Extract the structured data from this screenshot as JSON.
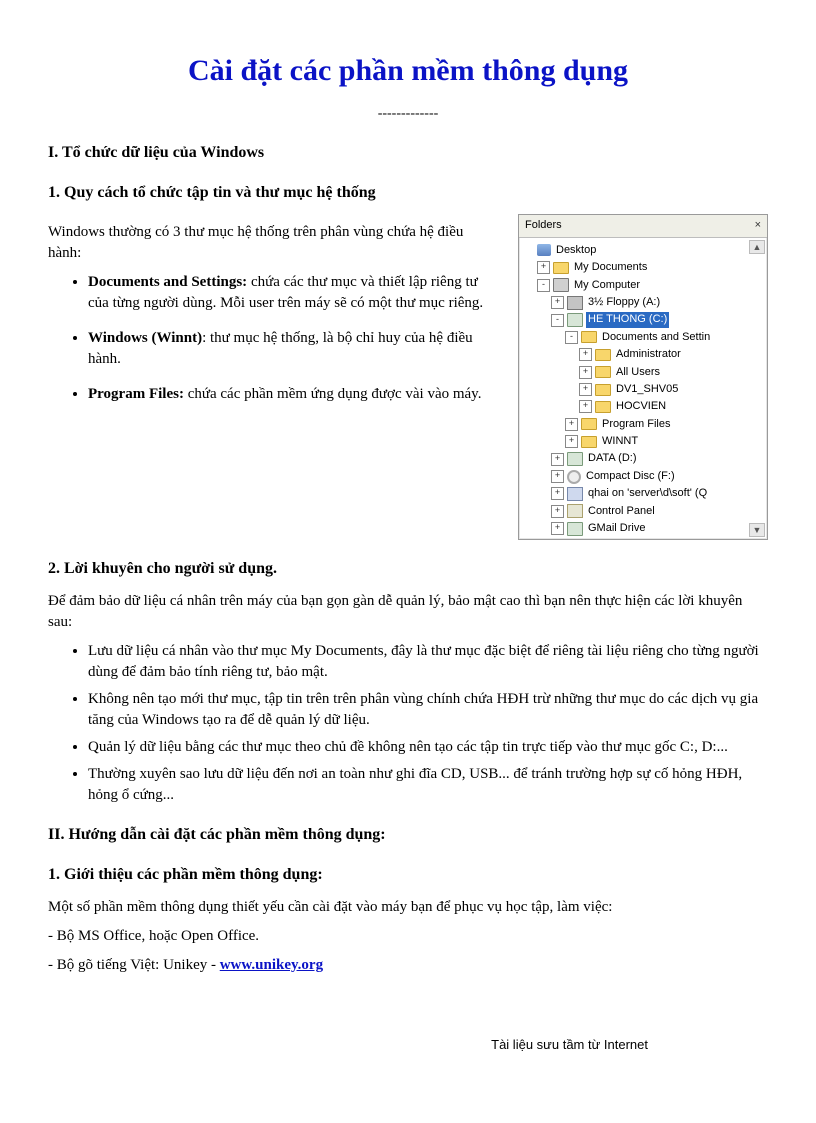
{
  "title": "Cài đặt các phần mềm thông dụng",
  "divider": "-------------",
  "section1": {
    "heading": "I.  Tổ chức dữ liệu của Windows",
    "sub1": {
      "heading": "1. Quy cách tổ chức tập tin và thư mục hệ thống",
      "intro": "Windows thường có 3 thư mục hệ thống trên phân vùng chứa hệ điều hành:",
      "bullets": [
        {
          "bold": "Documents and Settings:",
          "rest": " chứa các thư mục và thiết lập riêng tư của từng người dùng. Mỗi user trên máy sẽ có một thư mục riêng."
        },
        {
          "bold": "Windows (Winnt)",
          "rest": ": thư mục hệ thống, là bộ chỉ huy của hệ điều hành."
        },
        {
          "bold": "Program Files:",
          "rest": " chứa các phần mềm ứng dụng được vài vào máy."
        }
      ]
    },
    "sub2": {
      "heading": "2. Lời khuyên cho người sử dụng.",
      "intro": "Để đảm bảo dữ liệu cá nhân trên máy của bạn gọn gàn dễ quản lý, bảo mật cao thì bạn nên thực hiện các lời khuyên sau:",
      "bullets": [
        "Lưu dữ liệu cá nhân vào thư mục My Documents, đây là thư mục đặc biệt để riêng tài liệu riêng cho từng người dùng để đảm bảo tính riêng tư, bảo mật.",
        "Không nên tạo mới thư mục, tập tin trên trên phân vùng chính chứa HĐH trừ những thư mục do các dịch vụ gia tăng của Windows tạo ra để dễ quản lý dữ liệu.",
        "Quản lý dữ liệu bằng các thư mục theo chủ đề không nên tạo các tập tin trực tiếp vào thư mục gốc C:, D:...",
        "Thường xuyên sao lưu dữ liệu đến nơi an toàn như ghi đĩa CD, USB... để tránh trường hợp sự cố hỏng HĐH, hỏng ổ cứng..."
      ]
    }
  },
  "section2": {
    "heading": "II. Hướng dẫn cài đặt các phần mềm thông dụng:",
    "sub1": {
      "heading": "1. Giới thiệu các phần mềm thông dụng:",
      "intro": "Một số phần mềm thông dụng thiết yếu cần cài đặt vào máy bạn để phục vụ học tập, làm việc:",
      "line1": "- Bộ MS Office, hoặc Open Office.",
      "line2_prefix": "- Bộ gõ tiếng Việt: Unikey - ",
      "link": "www.unikey.org"
    }
  },
  "folders": {
    "title": "Folders",
    "close": "×",
    "scroll_up": "▲",
    "scroll_down": "▼",
    "nodes": [
      {
        "indent": 0,
        "exp": "",
        "icon": "desktop",
        "label": "Desktop",
        "sel": false
      },
      {
        "indent": 1,
        "exp": "+",
        "icon": "folder",
        "label": "My Documents",
        "sel": false
      },
      {
        "indent": 1,
        "exp": "-",
        "icon": "computer",
        "label": "My Computer",
        "sel": false
      },
      {
        "indent": 2,
        "exp": "+",
        "icon": "floppy",
        "label": "3½ Floppy (A:)",
        "sel": false
      },
      {
        "indent": 2,
        "exp": "-",
        "icon": "drive",
        "label": "HE THONG (C:)",
        "sel": true
      },
      {
        "indent": 3,
        "exp": "-",
        "icon": "folder",
        "label": "Documents and Settin",
        "sel": false
      },
      {
        "indent": 4,
        "exp": "+",
        "icon": "folder",
        "label": "Administrator",
        "sel": false
      },
      {
        "indent": 4,
        "exp": "+",
        "icon": "folder",
        "label": "All Users",
        "sel": false
      },
      {
        "indent": 4,
        "exp": "+",
        "icon": "folder",
        "label": "DV1_SHV05",
        "sel": false
      },
      {
        "indent": 4,
        "exp": "+",
        "icon": "folder",
        "label": "HOCVIEN",
        "sel": false
      },
      {
        "indent": 3,
        "exp": "+",
        "icon": "folder",
        "label": "Program Files",
        "sel": false
      },
      {
        "indent": 3,
        "exp": "+",
        "icon": "folder",
        "label": "WINNT",
        "sel": false
      },
      {
        "indent": 2,
        "exp": "+",
        "icon": "drive",
        "label": "DATA (D:)",
        "sel": false
      },
      {
        "indent": 2,
        "exp": "+",
        "icon": "cd",
        "label": "Compact Disc (F:)",
        "sel": false
      },
      {
        "indent": 2,
        "exp": "+",
        "icon": "network",
        "label": "qhai on 'server\\d\\soft' (Q",
        "sel": false
      },
      {
        "indent": 2,
        "exp": "+",
        "icon": "ctrl",
        "label": "Control Panel",
        "sel": false
      },
      {
        "indent": 2,
        "exp": "+",
        "icon": "drive",
        "label": "GMail Drive",
        "sel": false
      }
    ]
  },
  "footer": "Tài liệu sưu tầm từ Internet"
}
